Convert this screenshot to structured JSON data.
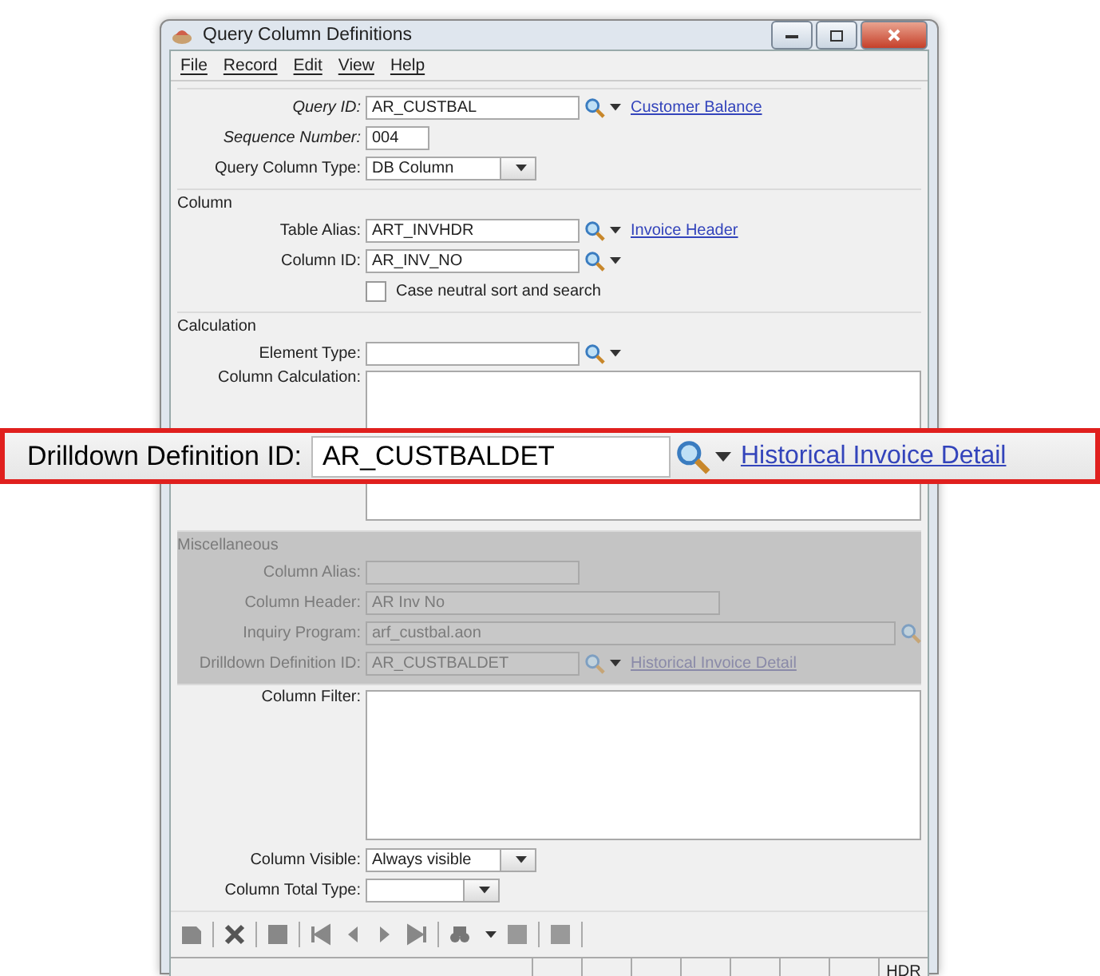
{
  "window": {
    "title": "Query Column Definitions"
  },
  "menu": [
    "File",
    "Record",
    "Edit",
    "View",
    "Help"
  ],
  "sections": [
    {
      "disabled": false,
      "fields": [
        {
          "kind": "lookup",
          "label": "Query ID:",
          "italic": true,
          "value": "AR_CUSTBAL",
          "link": "Customer Balance"
        },
        {
          "kind": "short",
          "label": "Sequence Number:",
          "italic": true,
          "value": "004"
        },
        {
          "kind": "select",
          "label": "Query Column Type:",
          "italic": false,
          "value": "DB Column"
        }
      ]
    },
    {
      "title": "Column",
      "disabled": false,
      "fields": [
        {
          "kind": "lookup",
          "label": "Table Alias:",
          "italic": false,
          "value": "ART_INVHDR",
          "link": "Invoice Header"
        },
        {
          "kind": "lookup",
          "label": "Column ID:",
          "italic": false,
          "value": "AR_INV_NO"
        },
        {
          "kind": "checkbox",
          "label": "Case neutral sort and search",
          "checked": false
        }
      ]
    },
    {
      "title": "Calculation",
      "disabled": false,
      "fields": [
        {
          "kind": "lookup",
          "label": "Element Type:",
          "italic": false
        },
        {
          "kind": "textarea",
          "label": "Column Calculation:",
          "italic": false
        }
      ]
    },
    {
      "title": "Miscellaneous",
      "disabled": true,
      "fields": [
        {
          "kind": "text",
          "label": "Column Alias:",
          "italic": false
        },
        {
          "kind": "long",
          "label": "Column Header:",
          "italic": false,
          "value": "AR Inv No"
        },
        {
          "kind": "wide",
          "label": "Inquiry Program:",
          "italic": false,
          "value": "arf_custbal.aon"
        },
        {
          "kind": "lookup",
          "label": "Drilldown Definition ID:",
          "italic": false,
          "value": "AR_CUSTBALDET",
          "link": "Historical Invoice Detail"
        }
      ]
    },
    {
      "disabled": false,
      "fields": [
        {
          "kind": "textarea",
          "label": "Column Filter:",
          "italic": false
        },
        {
          "kind": "select",
          "label": "Column Visible:",
          "italic": false,
          "value": "Always visible"
        },
        {
          "kind": "select",
          "label": "Column Total Type:",
          "italic": false
        }
      ]
    }
  ],
  "callout": {
    "label": "Drilldown Definition ID:",
    "value": "AR_CUSTBALDET",
    "link": "Historical Invoice Detail"
  },
  "status_bar": {
    "indicator": "HDR"
  }
}
